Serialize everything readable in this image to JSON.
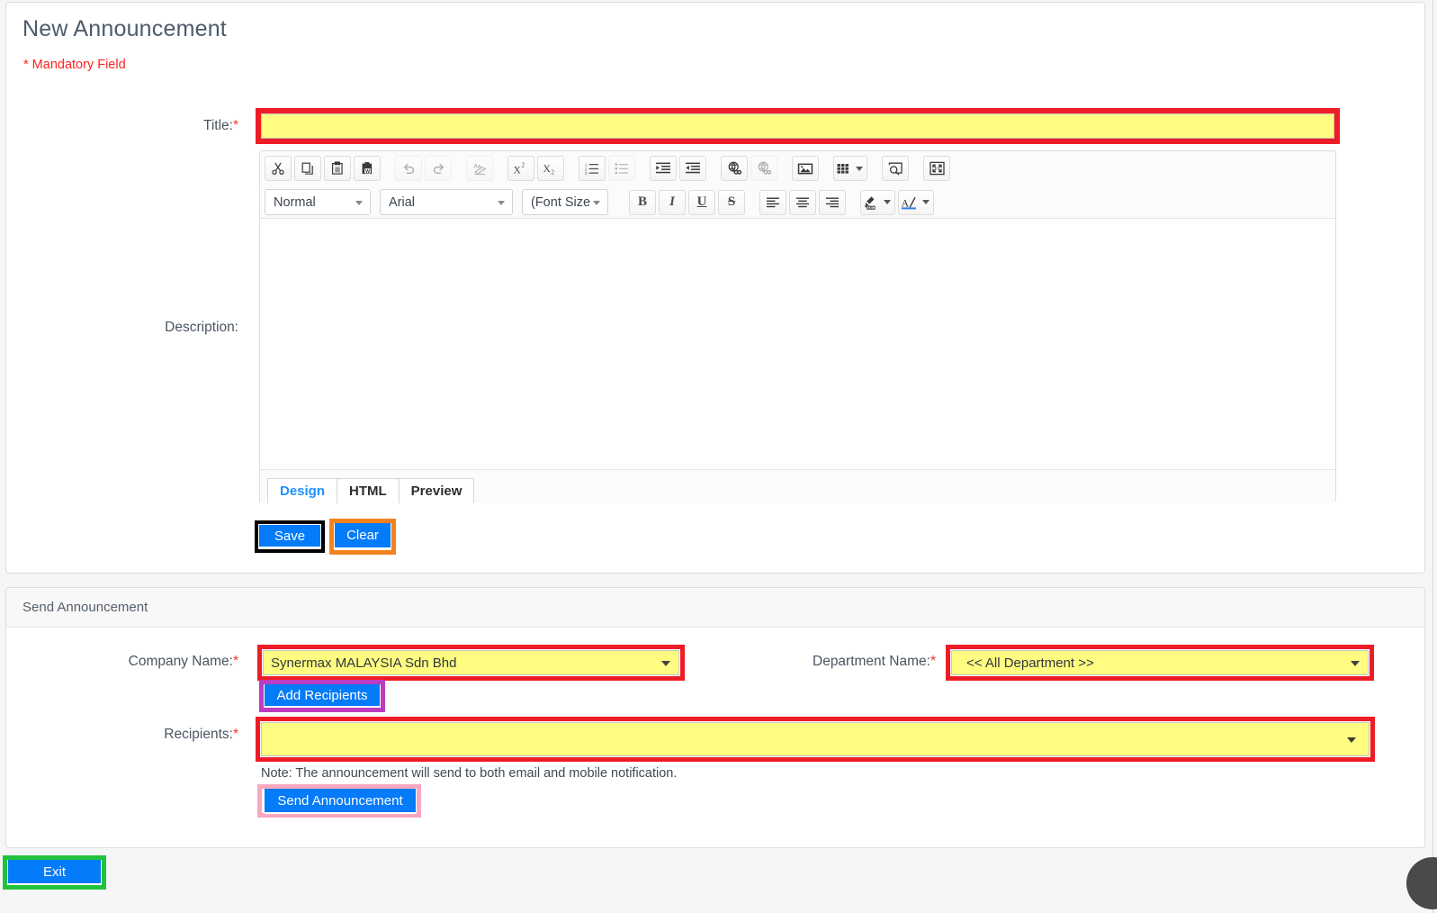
{
  "page": {
    "title": "New Announcement",
    "mandatory_note": "* Mandatory Field"
  },
  "form": {
    "title_label": "Title:",
    "title_value": "",
    "description_label": "Description:"
  },
  "editor": {
    "toolbar_row1": [
      {
        "name": "cut-icon",
        "label": "Cut"
      },
      {
        "name": "copy-icon",
        "label": "Copy"
      },
      {
        "name": "paste-icon",
        "label": "Paste"
      },
      {
        "name": "paste-from-word-icon",
        "label": "Paste from Word"
      },
      {
        "name": "undo-icon",
        "label": "Undo"
      },
      {
        "name": "redo-icon",
        "label": "Redo"
      },
      {
        "name": "remove-format-icon",
        "label": "Remove Format"
      },
      {
        "name": "superscript-icon",
        "label": "Superscript"
      },
      {
        "name": "subscript-icon",
        "label": "Subscript"
      },
      {
        "name": "numbered-list-icon",
        "label": "Numbered List"
      },
      {
        "name": "bulleted-list-icon",
        "label": "Bulleted List"
      },
      {
        "name": "indent-icon",
        "label": "Indent"
      },
      {
        "name": "outdent-icon",
        "label": "Outdent"
      },
      {
        "name": "insert-link-icon",
        "label": "Insert Link"
      },
      {
        "name": "unlink-icon",
        "label": "Unlink"
      },
      {
        "name": "insert-image-icon",
        "label": "Insert Image"
      },
      {
        "name": "insert-table-icon",
        "label": "Insert Table"
      },
      {
        "name": "find-replace-icon",
        "label": "Find"
      },
      {
        "name": "fullscreen-icon",
        "label": "Fullscreen"
      }
    ],
    "format_select": "Normal",
    "font_select": "Arial",
    "size_select": "(Font Size",
    "toolbar_row2": [
      {
        "name": "bold-icon",
        "label": "B"
      },
      {
        "name": "italic-icon",
        "label": "I"
      },
      {
        "name": "underline-icon",
        "label": "U"
      },
      {
        "name": "strikethrough-icon",
        "label": "S"
      },
      {
        "name": "align-left-icon",
        "label": "Align Left"
      },
      {
        "name": "align-center-icon",
        "label": "Align Center"
      },
      {
        "name": "align-right-icon",
        "label": "Align Right"
      },
      {
        "name": "highlight-color-icon",
        "label": "Highlight Color"
      },
      {
        "name": "text-color-icon",
        "label": "Text Color"
      }
    ],
    "body_value": "",
    "tabs": [
      {
        "label": "Design",
        "active": true
      },
      {
        "label": "HTML",
        "active": false
      },
      {
        "label": "Preview",
        "active": false
      }
    ]
  },
  "actions": {
    "save_label": "Save",
    "clear_label": "Clear",
    "exit_label": "Exit"
  },
  "send": {
    "header": "Send Announcement",
    "company_label": "Company Name:",
    "company_value": "Synermax MALAYSIA Sdn Bhd",
    "department_label": "Department Name:",
    "department_value": "<< All Department >>",
    "add_recipients_label": "Add Recipients",
    "recipients_label": "Recipients:",
    "recipients_value": "",
    "note": "Note: The announcement will send to both email and mobile notification.",
    "send_label": "Send Announcement"
  },
  "annotations": {
    "title_box": "#ee1c25",
    "save_box": "#000000",
    "clear_box": "#f58220",
    "company_box": "#ee1c25",
    "department_box": "#ee1c25",
    "add_recipients_box": "#bc3cc0",
    "recipients_box": "#ee1c25",
    "send_box": "#f7a8c0",
    "exit_box": "#22c33c"
  },
  "colors": {
    "accent_blue": "#047bf8",
    "field_yellow": "#fffc81",
    "required_red": "#ff2d2d"
  }
}
